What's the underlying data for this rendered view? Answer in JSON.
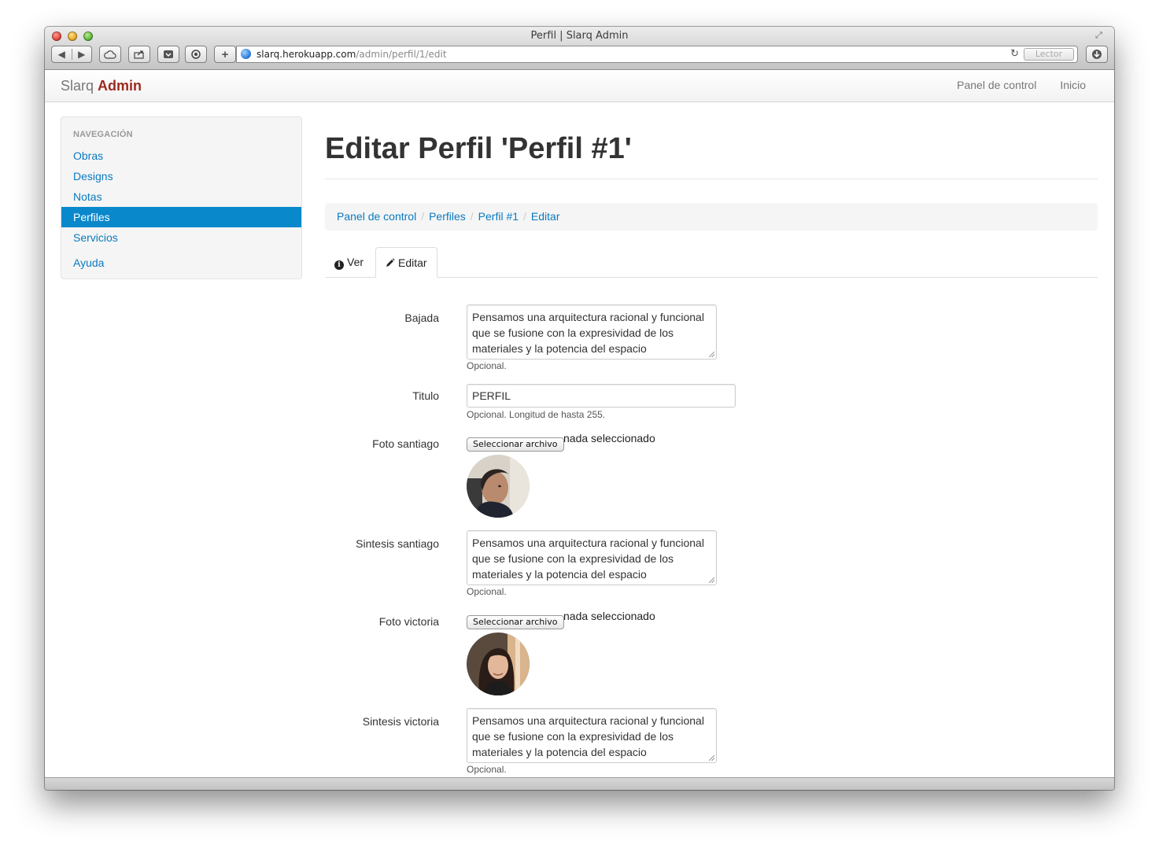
{
  "browser": {
    "window_title": "Perfil | Slarq Admin",
    "url_host": "slarq.herokuapp.com",
    "url_path": "/admin/perfil/1/edit",
    "reader_label": "Lector"
  },
  "navbar": {
    "brand_light": "Slarq",
    "brand_bold": "Admin",
    "links": [
      "Panel de control",
      "Inicio"
    ]
  },
  "sidebar": {
    "header": "NAVEGACIÓN",
    "items": [
      "Obras",
      "Designs",
      "Notas",
      "Perfiles",
      "Servicios"
    ],
    "help": "Ayuda",
    "active": "Perfiles"
  },
  "page": {
    "title": "Editar Perfil 'Perfil #1'",
    "breadcrumb": [
      "Panel de control",
      "Perfiles",
      "Perfil #1",
      "Editar"
    ],
    "tabs": [
      "Ver",
      "Editar"
    ]
  },
  "form": {
    "bajada": {
      "label": "Bajada",
      "value": "Pensamos una arquitectura racional y funcional que se fusione con la expresividad de los materiales y la potencia del espacio",
      "help": "Opcional."
    },
    "titulo": {
      "label": "Titulo",
      "value": "PERFIL",
      "help": "Opcional. Longitud de hasta 255."
    },
    "foto_santiago": {
      "label": "Foto santiago",
      "button": "Seleccionar archivo",
      "status": "nada seleccionado"
    },
    "sintesis_santiago": {
      "label": "Sintesis santiago",
      "value": "Pensamos una arquitectura racional y funcional que se fusione con la expresividad de los materiales y la potencia del espacio",
      "help": "Opcional."
    },
    "foto_victoria": {
      "label": "Foto victoria",
      "button": "Seleccionar archivo",
      "status": "nada seleccionado"
    },
    "sintesis_victoria": {
      "label": "Sintesis victoria",
      "value": "Pensamos una arquitectura racional y funcional que se fusione con la expresividad de los materiales y la potencia del espacio",
      "help": "Opcional."
    }
  },
  "colors": {
    "link": "#0a7ac0",
    "active_nav": "#0a88cc",
    "brand_accent": "#9c2a1f"
  }
}
